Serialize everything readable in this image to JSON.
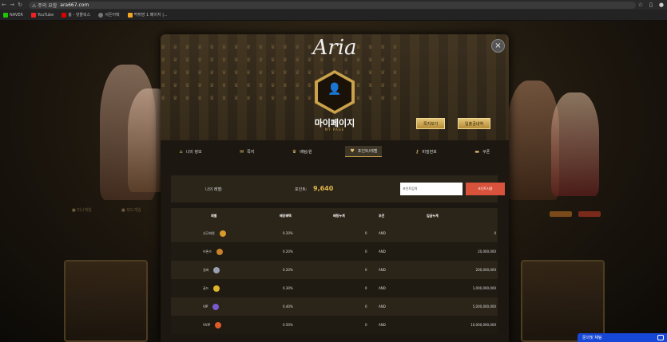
{
  "browser": {
    "warning": "⚠ 주의 요함",
    "url": "ara667.com",
    "bookmarks": [
      "NAVER",
      "YouTube",
      "홈 - 넷플릭스",
      "서든어택",
      "먹튀방 1 페이지 |..."
    ]
  },
  "background": {
    "tabs": [
      "■ 미니게임",
      "■ 보드게임"
    ]
  },
  "modal": {
    "logo": "Aria",
    "title": "마이페이지",
    "subtitle": "MY PAGE",
    "btn_notes": "쪽지보기",
    "btn_deposit": "입출금내역",
    "close": "×"
  },
  "tabs": [
    {
      "icon": "home-icon",
      "glyph": "⌂",
      "label": "나의 정보"
    },
    {
      "icon": "mail-icon",
      "glyph": "✉",
      "label": "쪽지"
    },
    {
      "icon": "trophy-icon",
      "glyph": "♛",
      "label": "배팅/윈"
    },
    {
      "icon": "heart-icon",
      "glyph": "♥",
      "label": "포인트/레벨"
    },
    {
      "icon": "key-icon",
      "glyph": "⚷",
      "label": "비밀번호"
    },
    {
      "icon": "ticket-icon",
      "glyph": "▬",
      "label": "쿠폰"
    }
  ],
  "level_box": {
    "my_level_label": "나의 레벨:",
    "points_label": "포인트:",
    "points_value": "9,640",
    "input_placeholder": "포인트입력",
    "convert_button": "포인트사용"
  },
  "table": {
    "headers": [
      "레벨",
      "배당혜택",
      "배팅누계",
      "조건",
      "입금누계"
    ],
    "rows": [
      {
        "level": "신규회원",
        "badge_color": "#d79a2a",
        "bonus": "0.20%",
        "bet_total": "0",
        "condition": "AND",
        "deposit_total": "0"
      },
      {
        "level": "브론즈",
        "badge_color": "#c9822a",
        "bonus": "0.20%",
        "bet_total": "0",
        "condition": "AND",
        "deposit_total": "20,000,000"
      },
      {
        "level": "실버",
        "badge_color": "#9aa0b4",
        "bonus": "0.20%",
        "bet_total": "0",
        "condition": "AND",
        "deposit_total": "200,000,000"
      },
      {
        "level": "골드",
        "badge_color": "#e0b52a",
        "bonus": "0.30%",
        "bet_total": "0",
        "condition": "AND",
        "deposit_total": "1,000,000,000"
      },
      {
        "level": "VIP",
        "badge_color": "#7a5ad0",
        "bonus": "0.40%",
        "bet_total": "0",
        "condition": "AND",
        "deposit_total": "5,000,000,000"
      },
      {
        "level": "VVIP",
        "badge_color": "#e05a2a",
        "bonus": "0.50%",
        "bet_total": "0",
        "condition": "AND",
        "deposit_total": "10,000,000,000"
      }
    ]
  },
  "chat": {
    "label": "문의및 채팅"
  }
}
